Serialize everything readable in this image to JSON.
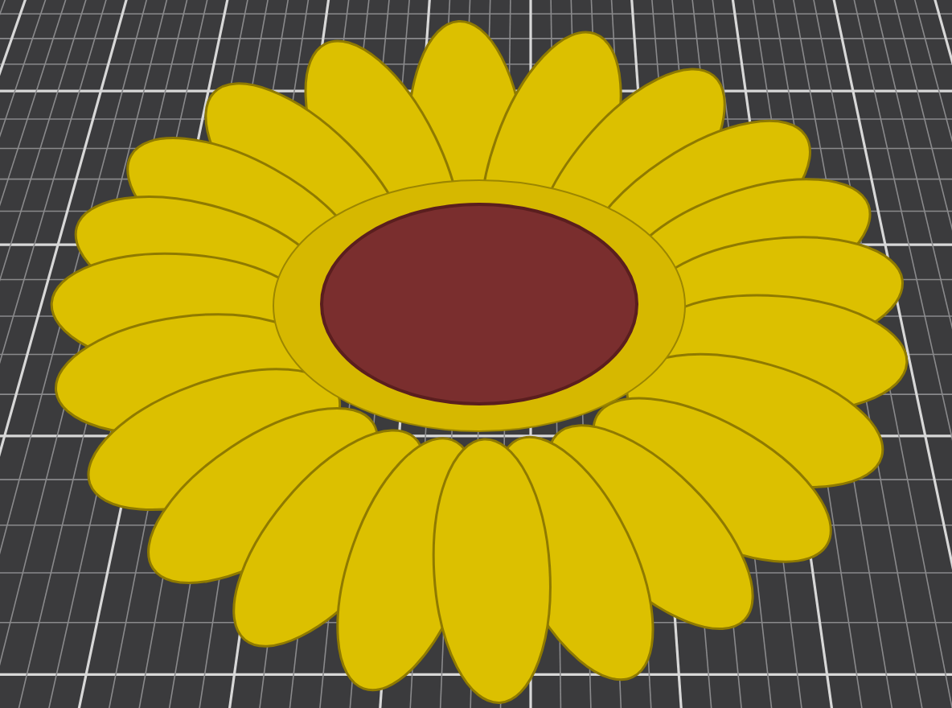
{
  "viewport": {
    "grid": true,
    "model_visible": true
  }
}
